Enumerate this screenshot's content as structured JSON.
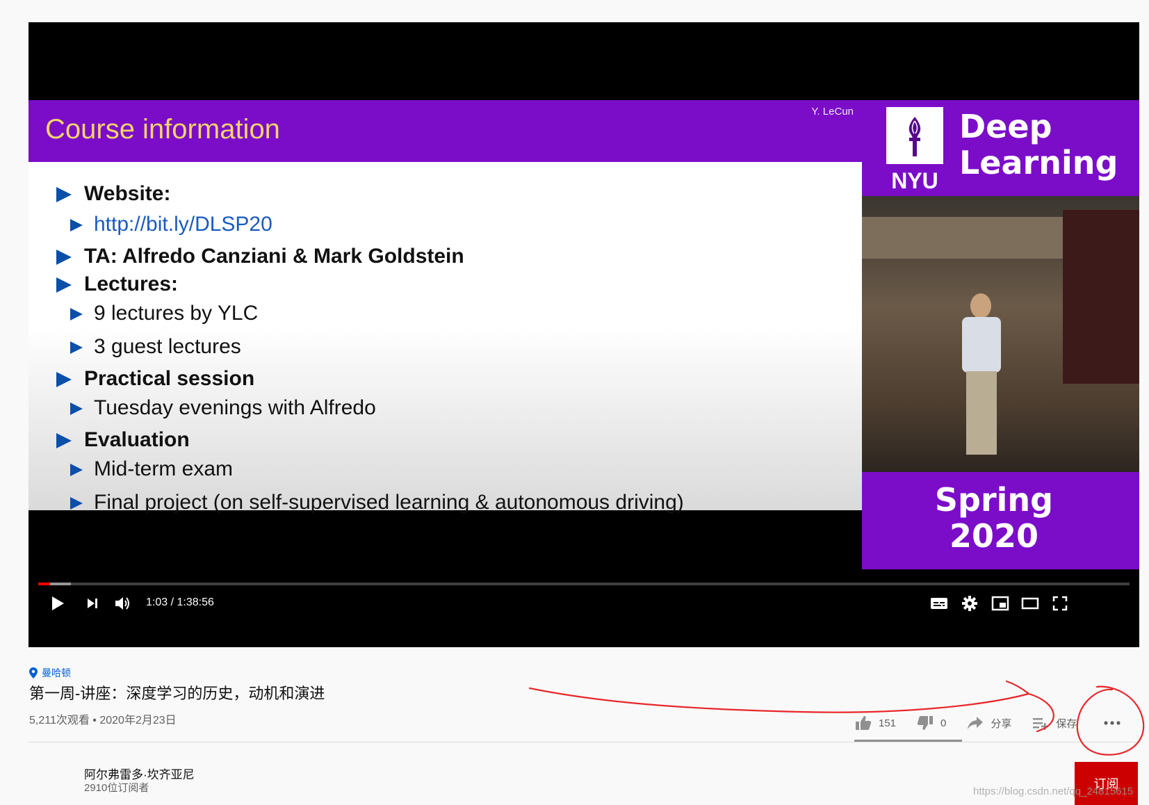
{
  "slide": {
    "title": "Course information",
    "author": "Y. LeCun",
    "bullets": [
      {
        "text": "Website:"
      },
      {
        "text": "http://bit.ly/DLSP20"
      },
      {
        "text": "TA: Alfredo Canziani & Mark Goldstein"
      },
      {
        "text": "Lectures:"
      },
      {
        "text": "9 lectures by YLC"
      },
      {
        "text": "3 guest lectures"
      },
      {
        "text": "Practical session"
      },
      {
        "text": "Tuesday evenings with Alfredo"
      },
      {
        "text": "Evaluation"
      },
      {
        "text": "Mid-term exam"
      },
      {
        "text": "Final project (on self-supervised learning & autonomous driving)"
      }
    ]
  },
  "sidebar": {
    "logo_text": "NYU",
    "course_title_line1": "Deep",
    "course_title_line2": "Learning",
    "term_line1": "Spring",
    "term_line2": "2020"
  },
  "player": {
    "time": "1:03 / 1:38:56",
    "progress_fraction": 0.0106,
    "buffered_fraction": 0.03,
    "progress_color": "#ff0000",
    "controls": {
      "play": "play-icon",
      "next": "next-icon",
      "volume": "volume-icon",
      "captions": "captions-icon",
      "settings": "gear-icon",
      "miniplayer": "miniplayer-icon",
      "theater": "theater-icon",
      "fullscreen": "fullscreen-icon"
    }
  },
  "video": {
    "location": "曼哈顿",
    "title": "第一周-讲座：深度学习的历史，动机和演进",
    "meta": "5,211次观看 • 2020年2月23日",
    "likes": "151",
    "dislikes": "0",
    "share_label": "分享",
    "save_label": "保存",
    "like_fraction": 1.0
  },
  "channel": {
    "name": "阿尔弗雷多·坎齐亚尼",
    "subscribers": "2910位订阅者",
    "subscribe_label": "订阅",
    "subscribe_color": "#cc0000"
  },
  "watermark": "https://blog.csdn.net/qq_24815615"
}
